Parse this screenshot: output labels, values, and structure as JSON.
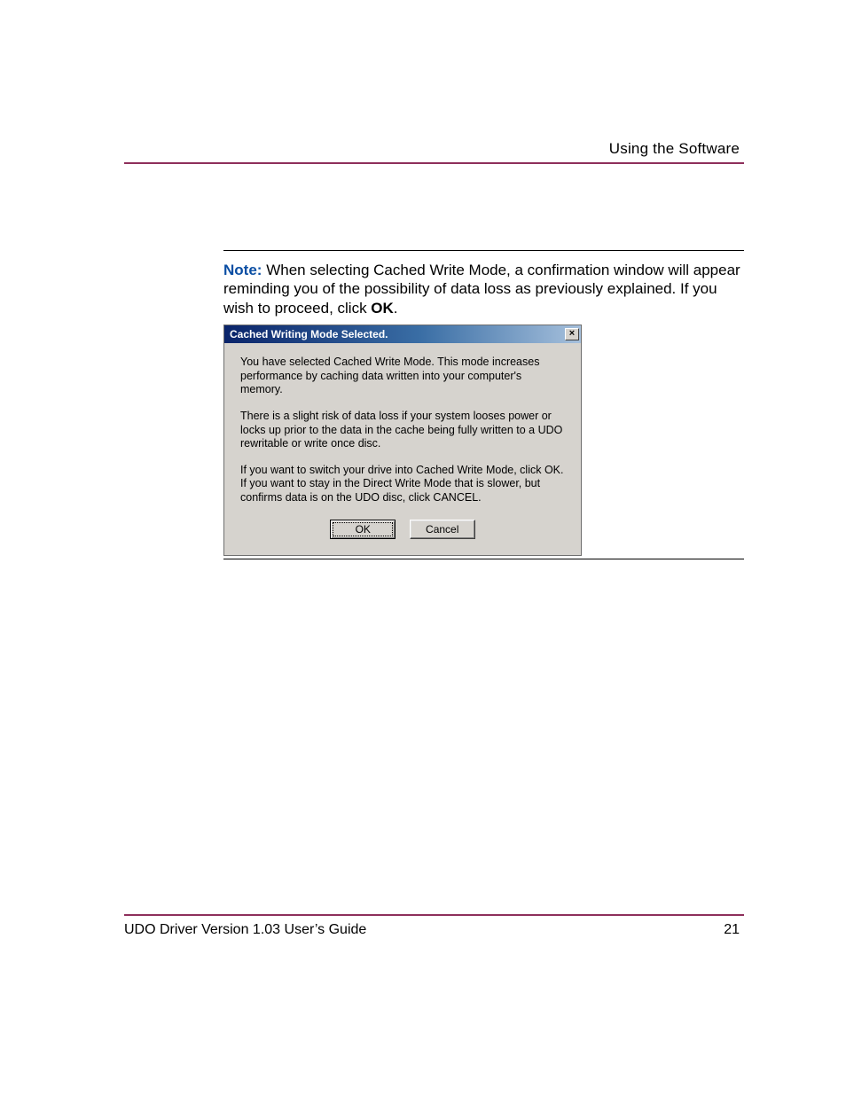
{
  "header": {
    "section_title": "Using the Software"
  },
  "note": {
    "label": "Note:",
    "text_part1": "When selecting Cached Write Mode, a confirmation window will appear reminding you of the possibility of data loss as previously explained. If you wish to proceed, click ",
    "ok_word": "OK",
    "text_part2": "."
  },
  "dialog": {
    "title": "Cached Writing Mode Selected.",
    "close_glyph": "×",
    "para1": "You have selected Cached Write Mode.  This mode increases performance by caching data written into your computer's memory.",
    "para2": "There is a slight risk of data loss if your system looses power or locks up prior to the data in the cache being fully written to a UDO rewritable or write once disc.",
    "para3": "If you want to switch your drive into Cached Write Mode, click OK.  If you want to stay in the Direct Write Mode that is slower, but confirms data is on the UDO disc, click CANCEL.",
    "ok_label": "OK",
    "cancel_label": "Cancel"
  },
  "footer": {
    "guide": "UDO Driver Version 1.03 User’s Guide",
    "page": "21"
  }
}
